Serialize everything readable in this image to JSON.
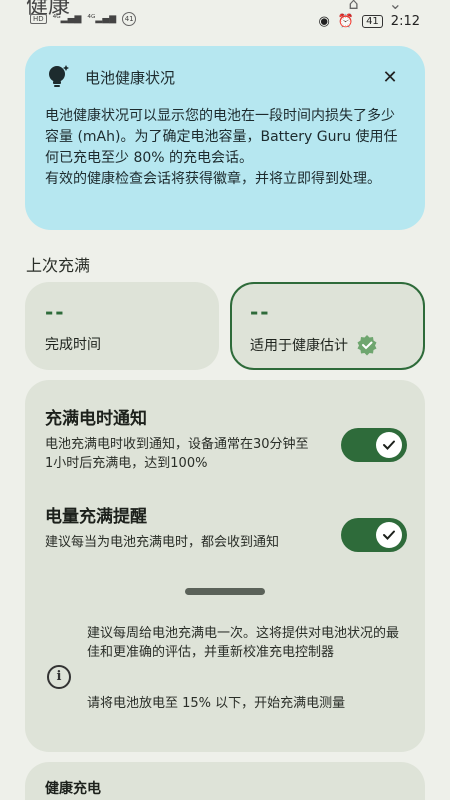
{
  "statusbar": {
    "page_title_cut": "健康",
    "left_text": "HD 4G 46 41",
    "time": "2:12",
    "battery": "41"
  },
  "info_card": {
    "title": "电池健康状况",
    "paragraph1": "电池健康状况可以显示您的电池在一段时间内损失了多少容量 (mAh)。为了确定电池容量，Battery Guru 使用任何已充电至少 80% 的充电会话。",
    "paragraph2": "有效的健康检查会话将获得徽章，并将立即得到处理。",
    "close": "✕"
  },
  "section": {
    "last_full_charge": "上次充满"
  },
  "stats": {
    "completion_time": {
      "value": "--",
      "label": "完成时间"
    },
    "health_estimate": {
      "value": "--",
      "label": "适用于健康估计"
    }
  },
  "settings": {
    "full_notify": {
      "title": "充满电时通知",
      "desc": "电池充满电时收到通知，设备通常在30分钟至1小时后充满电，达到100%",
      "enabled": true
    },
    "full_reminder": {
      "title": "电量充满提醒",
      "desc": "建议每当为电池充满电时，都会收到通知",
      "enabled": true
    },
    "tip1": "建议每周给电池充满电一次。这将提供对电池状况的最佳和更准确的评估，并重新校准充电控制器",
    "tip2": "请将电池放电至 15% 以下，开始充满电测量"
  },
  "bottom": {
    "title": "健康充电"
  },
  "colors": {
    "accent": "#2e6b3a",
    "info_bg": "#b6e7f0",
    "card_bg": "#dee3d8",
    "page_bg": "#eef0ea"
  }
}
